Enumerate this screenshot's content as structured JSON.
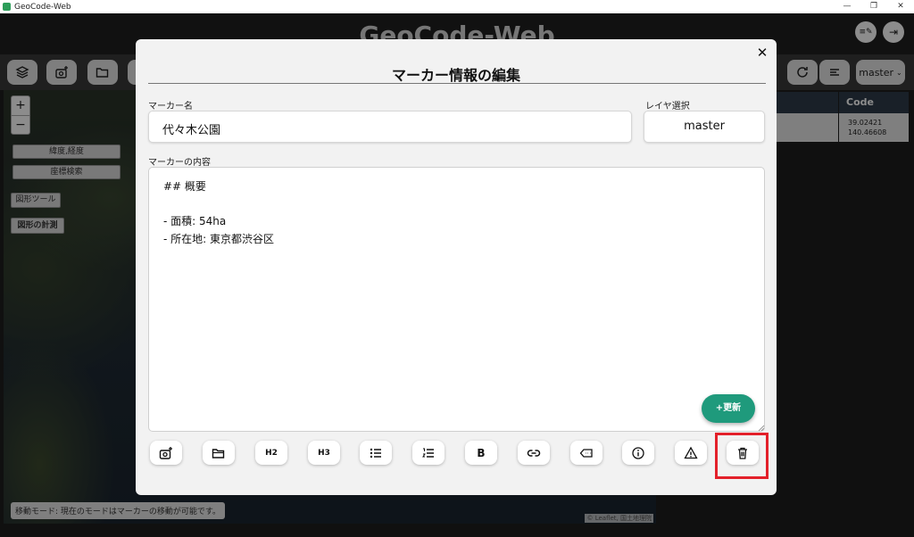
{
  "window": {
    "title": "GeoCode-Web",
    "min": "—",
    "restore": "❐",
    "close": "✕"
  },
  "header": {
    "title": "GeoCode-Web",
    "edit_icon": "≡✎",
    "logout_icon": "⇥"
  },
  "toolbar": {
    "layer_select_value": "master"
  },
  "map": {
    "zoom_in": "+",
    "zoom_out": "−",
    "latlng_button": "緯度,経度",
    "coord_search_button": "座標検索",
    "shape_tools_button": "図形ツール",
    "shape_measure_button": "図形の計測",
    "status": "移動モード: 現在のモードはマーカーの移動が可能です。",
    "attribution": "© Leaflet, 国土地理院"
  },
  "table": {
    "header_code": "Code",
    "coord_lat": "39.02421",
    "coord_lng": "140.46608"
  },
  "modal": {
    "title": "マーカー情報の編集",
    "close": "✕",
    "name_label": "マーカー名",
    "name_value": "代々木公園",
    "layer_label": "レイヤ選択",
    "layer_value": "master",
    "content_label": "マーカーの内容",
    "content_lines": [
      "## 概要",
      "",
      "- 面積: 54ha",
      "- 所在地: 東京都渋谷区"
    ],
    "update_button": "+更新",
    "edit_toolbar": {
      "h2": "H2",
      "h3": "H3",
      "bold": "B"
    }
  },
  "colors": {
    "accent": "#1f9a7c",
    "highlight": "#e3202a",
    "header_bg": "#1f1f1f"
  }
}
